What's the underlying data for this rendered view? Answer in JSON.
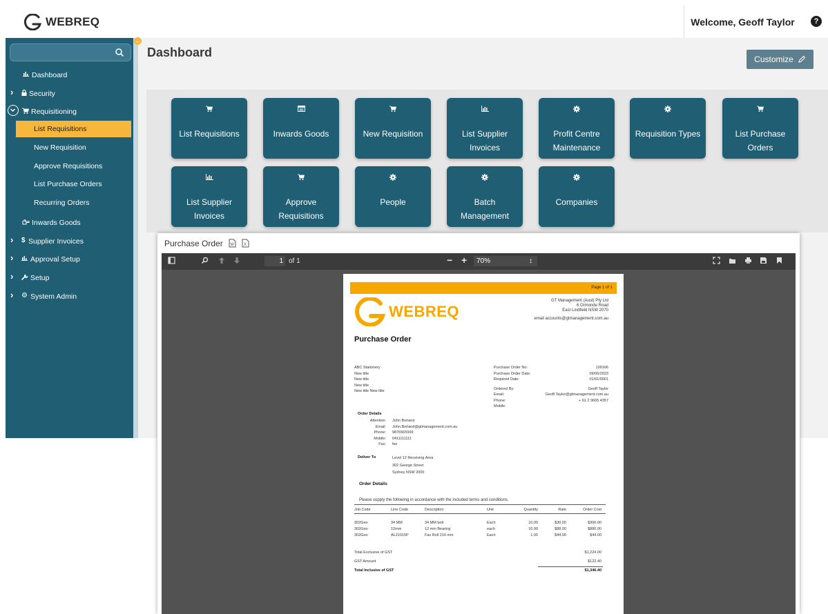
{
  "app": {
    "logo": "WEBREQ",
    "welcome": "Welcome, Geoff Taylor",
    "help_symbol": "?"
  },
  "sidebar": {
    "search_placeholder": "",
    "items": [
      {
        "label": "Dashboard"
      },
      {
        "label": "Security"
      },
      {
        "label": "Requisitioning"
      },
      {
        "label": "Inwards Goods"
      },
      {
        "label": "Supplier Invoices"
      },
      {
        "label": "Approval Setup"
      },
      {
        "label": "Setup"
      },
      {
        "label": "System Admin"
      }
    ],
    "sub_items": [
      {
        "label": "List Requisitions",
        "active": true
      },
      {
        "label": "New Requisition"
      },
      {
        "label": "Approve Requisitions"
      },
      {
        "label": "List Purchase Orders"
      },
      {
        "label": "Recurring Orders"
      }
    ]
  },
  "main": {
    "title": "Dashboard",
    "customize_label": "Customize",
    "tiles": [
      {
        "label": "List Requisitions",
        "icon": "cart-icon"
      },
      {
        "label": "Inwards Goods",
        "icon": "box-icon"
      },
      {
        "label": "New Requisition",
        "icon": "cart-icon"
      },
      {
        "label": "List Supplier Invoices",
        "icon": "chart-icon"
      },
      {
        "label": "Profit Centre Maintenance",
        "icon": "gear-icon"
      },
      {
        "label": "Requisition Types",
        "icon": "gear-icon"
      },
      {
        "label": "List Purchase Orders",
        "icon": "cart-icon"
      },
      {
        "label": "List Supplier Invoices",
        "icon": "chart-icon"
      },
      {
        "label": "Approve Requisitions",
        "icon": "cart-icon"
      },
      {
        "label": "People",
        "icon": "gear-icon"
      },
      {
        "label": "Batch Management",
        "icon": "gear-icon"
      },
      {
        "label": "Companies",
        "icon": "gear-icon"
      }
    ]
  },
  "viewer": {
    "title": "Purchase Order",
    "toolbar": {
      "page_number": "1",
      "page_total": "of 1",
      "zoom": "70%"
    },
    "doc": {
      "page_label": "Page 1 of 1",
      "logo": "WEBREQ",
      "company_lines": [
        "GT Management (Aust) Pty Ltd",
        "6 Ormonde Road",
        "East Lindfield NSW 2070"
      ],
      "email_line": "email accounts@gtmanagement.com.au",
      "heading": "Purchase Order",
      "supplier_lines": [
        "ABC Stationery",
        "New title",
        "New title",
        "New title",
        "New title    New title"
      ],
      "info_labels": [
        "Purchase Order No:",
        "Purchase Order Date:",
        "Required Date:",
        "",
        "Ordered By:",
        "Email:",
        "Phone:",
        "Mobile:"
      ],
      "info_values": [
        "100166",
        "09/06/2023",
        "01/01/0001",
        "",
        "Geoff Taylor",
        "Geoff.Taylor@gtmanagement.com.au",
        "+ 61 2 9665 4357",
        ""
      ],
      "order_details_heading": "Order Details",
      "contact_labels": [
        "Attention:",
        "Email:",
        "Phone:",
        "Mobile:",
        "Fax:"
      ],
      "contact_values": [
        "John Borland",
        "John.Borland@gtmanagement.com.au",
        "9876565999",
        "0411111111",
        "fax"
      ],
      "deliver_to_label": "Deliver To",
      "deliver_lines": [
        "Level 12 Receiving Area",
        "302 George Street",
        "Sydney  NSW  2000"
      ],
      "order_details_heading_2": "Order Details",
      "instruction": "Please supply the following in accordance with the included terms and conditions.",
      "columns": [
        "Job Code",
        "Line Code",
        "Description",
        "Unit",
        "Quantity",
        "Rate",
        "Order Cost"
      ],
      "rows": [
        [
          "302Geo",
          "34 MM",
          "34 MM bolt",
          "Each",
          "10.00",
          "$30.00",
          "$300.00"
        ],
        [
          "302Geo",
          "12mm",
          "12 mm Bearing",
          "each",
          "10.00",
          "$88.00",
          "$880.00"
        ],
        [
          "302Geo",
          "AL21015P",
          "Fax Roll 210 mm",
          "Each",
          "1.00",
          "$44.00",
          "$44.00"
        ]
      ],
      "total_ex_label": "Total Exclusive of GST",
      "total_ex_value": "$1,224.00",
      "gst_label": "GST Amount",
      "gst_value": "$122.40",
      "total_inc_label": "Total Inclusive of GST",
      "total_inc_value": "$1,346.40"
    }
  },
  "colors": {
    "brand_teal": "#1f5e73",
    "accent_orange": "#f6b73c",
    "pdf_orange": "#f6a800"
  }
}
